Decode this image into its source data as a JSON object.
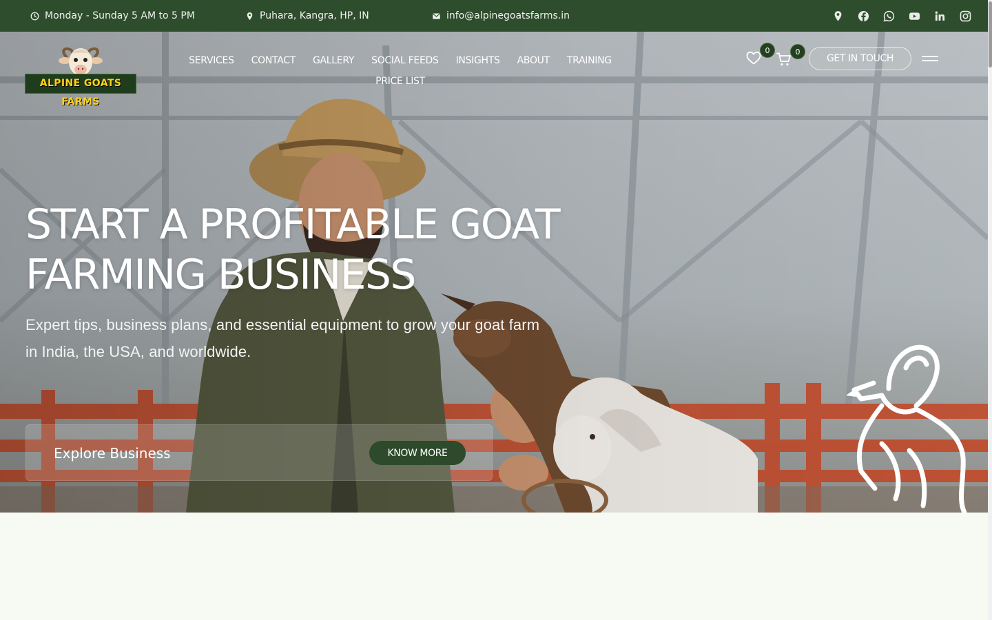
{
  "topbar": {
    "hours": "Monday - Sunday 5 AM to 5 PM",
    "location": "Puhara, Kangra, HP, IN",
    "email": "info@alpinegoatsfarms.in",
    "socials": [
      {
        "icon": "map-pin-icon"
      },
      {
        "icon": "facebook-icon"
      },
      {
        "icon": "whatsapp-icon"
      },
      {
        "icon": "youtube-icon"
      },
      {
        "icon": "linkedin-icon"
      },
      {
        "icon": "instagram-icon"
      }
    ]
  },
  "header": {
    "logo_text": "ALPINE GOATS FARMS",
    "nav": [
      "SERVICES",
      "CONTACT",
      "GALLERY",
      "SOCIAL FEEDS",
      "INSIGHTS",
      "ABOUT",
      "TRAINING",
      "PRICE LIST"
    ],
    "wishlist_count": "0",
    "cart_count": "0",
    "cta_label": "GET IN TOUCH"
  },
  "hero": {
    "title_line1": "START A PROFITABLE GOAT",
    "title_line2": "FARMING BUSINESS",
    "subtitle": "Expert tips, business plans, and essential equipment to grow your goat farm in India, the USA, and worldwide.",
    "explore_label": "Explore Business",
    "know_more_label": "KNOW MORE"
  },
  "colors": {
    "topbar_bg": "#2e4d2c",
    "accent_green": "#2d4a2a",
    "page_bg": "#f6faf2",
    "logo_text": "#ffd21a"
  }
}
